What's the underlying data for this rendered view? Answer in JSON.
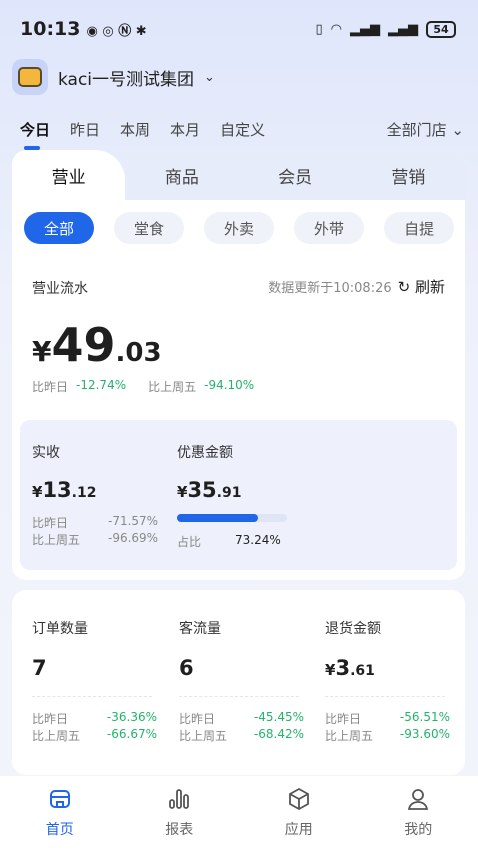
{
  "status_bar": {
    "time": "10:13",
    "battery": "54"
  },
  "org": {
    "name": "kaci一号测试集团"
  },
  "periods": {
    "items": [
      "今日",
      "昨日",
      "本周",
      "本月",
      "自定义"
    ],
    "store_filter": "全部门店"
  },
  "main_tabs": [
    "营业",
    "商品",
    "会员",
    "营销"
  ],
  "chips": [
    "全部",
    "堂食",
    "外卖",
    "外带",
    "自提"
  ],
  "flow": {
    "label": "营业流水",
    "update_text": "数据更新于10:08:26",
    "refresh": "刷新",
    "currency": "¥",
    "amount_int": "49",
    "amount_dec": ".03",
    "cmp_yesterday_label": "比昨日",
    "cmp_yesterday": "-12.74%",
    "cmp_lastweek_label": "比上周五",
    "cmp_lastweek": "-94.10%"
  },
  "received": {
    "label": "实收",
    "currency": "¥",
    "int": "13",
    "dec": ".12",
    "yesterday_label": "比昨日",
    "yesterday": "-71.57%",
    "lastweek_label": "比上周五",
    "lastweek": "-96.69%"
  },
  "discount": {
    "label": "优惠金额",
    "currency": "¥",
    "int": "35",
    "dec": ".91",
    "ratio_label": "占比",
    "ratio": "73.24%",
    "ratio_value": 73.24
  },
  "stats": [
    {
      "label": "订单数量",
      "value": "7",
      "currency": "",
      "dec": "",
      "yesterday_label": "比昨日",
      "yesterday": "-36.36%",
      "lastweek_label": "比上周五",
      "lastweek": "-66.67%"
    },
    {
      "label": "客流量",
      "value": "6",
      "currency": "",
      "dec": "",
      "yesterday_label": "比昨日",
      "yesterday": "-45.45%",
      "lastweek_label": "比上周五",
      "lastweek": "-68.42%"
    },
    {
      "label": "退货金额",
      "value": "3",
      "currency": "¥",
      "dec": ".61",
      "yesterday_label": "比昨日",
      "yesterday": "-56.51%",
      "lastweek_label": "比上周五",
      "lastweek": "-93.60%"
    }
  ],
  "nav": [
    "首页",
    "报表",
    "应用",
    "我的"
  ],
  "colors": {
    "accent": "#2066e8",
    "positive_change": "#23b36b"
  }
}
